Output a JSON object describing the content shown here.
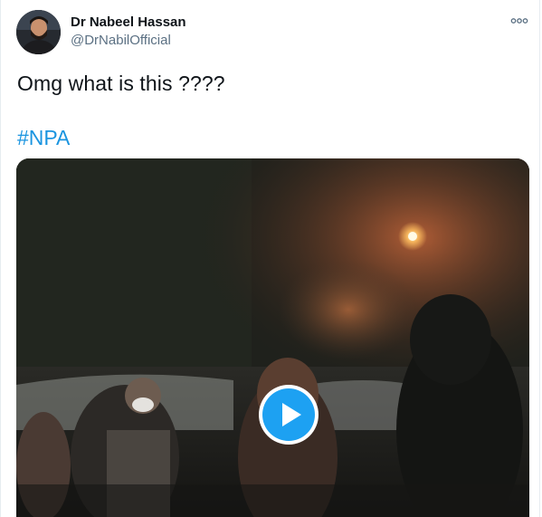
{
  "tweet": {
    "author_name": "Dr Nabeel Hassan",
    "author_handle": "@DrNabilOfficial",
    "text": "Omg what is this ????",
    "hashtag": "#NPA",
    "more_icon": "more-horizontal-icon"
  },
  "media": {
    "type": "video",
    "play_icon": "play-icon"
  },
  "colors": {
    "accent": "#1da1f2",
    "hashtag": "#1b95e0",
    "secondary_text": "#5b7083"
  }
}
